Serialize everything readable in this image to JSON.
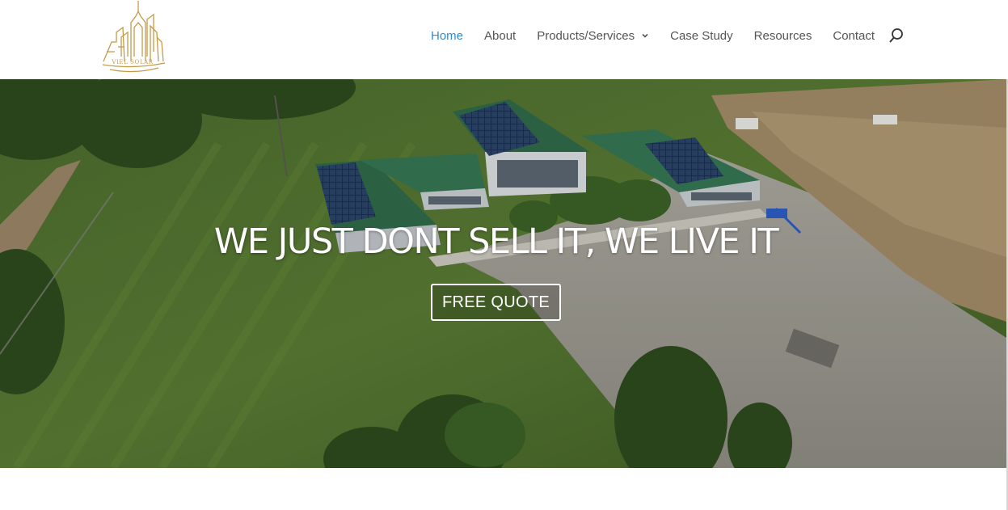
{
  "brand": {
    "name": "VIEL SOLAR",
    "color": "#c59b4a"
  },
  "nav": {
    "items": [
      {
        "label": "Home",
        "active": true
      },
      {
        "label": "About"
      },
      {
        "label": "Products/Services",
        "has_dropdown": true
      },
      {
        "label": "Case Study"
      },
      {
        "label": "Resources"
      },
      {
        "label": "Contact"
      }
    ],
    "search_icon": "search-icon",
    "active_color": "#2e8bd4"
  },
  "hero": {
    "title": "WE JUST DONT SELL IT, WE LIVE IT",
    "cta_label": "FREE QUOTE",
    "background": "aerial photo of solar-panel building"
  }
}
